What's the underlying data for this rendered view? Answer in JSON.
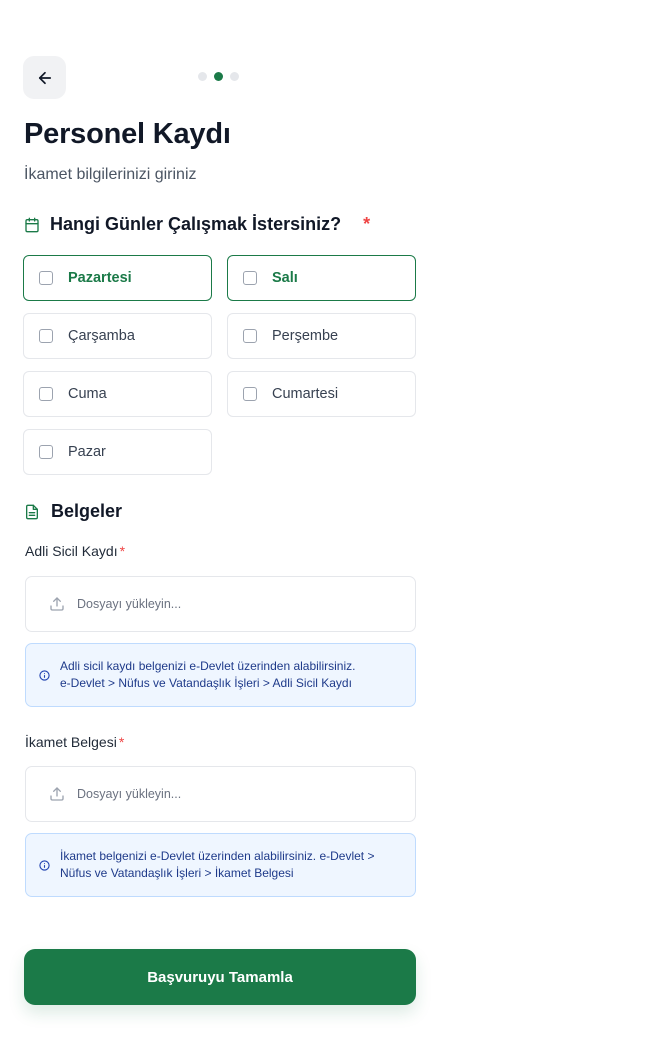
{
  "header": {
    "step_dots": 3,
    "active_step": 2,
    "title": "Personel Kaydı",
    "subtitle": "İkamet bilgilerinizi giriniz"
  },
  "days_section": {
    "title": "Hangi Günler Çalışmak İstersiniz?",
    "required_mark": "*",
    "days": [
      {
        "label": "Pazartesi",
        "checked": false,
        "highlighted": true
      },
      {
        "label": "Salı",
        "checked": false,
        "highlighted": true
      },
      {
        "label": "Çarşamba",
        "checked": false,
        "highlighted": false
      },
      {
        "label": "Perşembe",
        "checked": false,
        "highlighted": false
      },
      {
        "label": "Cuma",
        "checked": false,
        "highlighted": false
      },
      {
        "label": "Cumartesi",
        "checked": false,
        "highlighted": false
      },
      {
        "label": "Pazar",
        "checked": false,
        "highlighted": false
      }
    ]
  },
  "documents_section": {
    "title": "Belgeler",
    "fields": [
      {
        "label": "Adli Sicil Kaydı",
        "required_mark": "*",
        "placeholder": "Dosyayı yükleyin...",
        "info_line1": "Adli sicil kaydı belgenizi e-Devlet üzerinden alabilirsiniz.",
        "info_line2": "e-Devlet > Nüfus ve Vatandaşlık İşleri > Adli Sicil Kaydı"
      },
      {
        "label": "İkamet Belgesi",
        "required_mark": "*",
        "placeholder": "Dosyayı yükleyin...",
        "info_line1": "İkamet belgenizi e-Devlet üzerinden alabilirsiniz. e-Devlet >",
        "info_line2": "Nüfus ve Vatandaşlık İşleri > İkamet Belgesi"
      }
    ]
  },
  "submit_label": "Başvuruyu Tamamla",
  "colors": {
    "primary": "#1b7a48",
    "required": "#ef4444",
    "info_bg": "#eff6ff",
    "info_border": "#bfdbfe",
    "info_text": "#1e3a8a"
  },
  "icons": {
    "back": "arrow-left-icon",
    "days_section": "calendar-icon",
    "documents_section": "document-icon",
    "upload": "upload-icon",
    "info": "info-icon"
  }
}
